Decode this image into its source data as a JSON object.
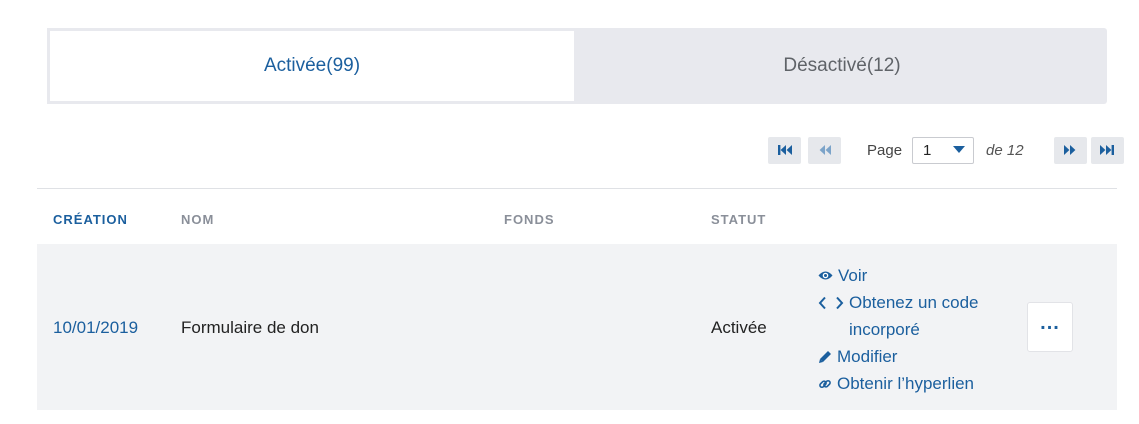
{
  "tabs": [
    {
      "label": "Activée(99)",
      "active": true
    },
    {
      "label": "Désactivé(12)",
      "active": false
    }
  ],
  "pagination": {
    "page_label": "Page",
    "current_page": "1",
    "of_label": "de 12",
    "buttons": [
      "first-page-icon",
      "previous-page-icon",
      "next-page-icon",
      "last-page-icon"
    ]
  },
  "table": {
    "headers": [
      "CRÉATION",
      "NOM",
      "FONDS",
      "STATUT"
    ],
    "rows": [
      {
        "creation": "10/01/2019",
        "nom": "Formulaire de don",
        "fonds": "",
        "statut": "Activée",
        "actions": [
          {
            "icon": "eye-icon",
            "label": "Voir"
          },
          {
            "icon": "code-icon",
            "label": "Obtenez un code incorporé"
          },
          {
            "icon": "pencil-icon",
            "label": "Modifier"
          },
          {
            "icon": "link-icon",
            "label": "Obtenir l’hyperlien"
          }
        ],
        "more_label": "..."
      }
    ]
  },
  "colors": {
    "accent": "#1b5f9e",
    "row_bg": "#f2f3f5",
    "tab_inactive_bg": "#e8e9ee"
  }
}
